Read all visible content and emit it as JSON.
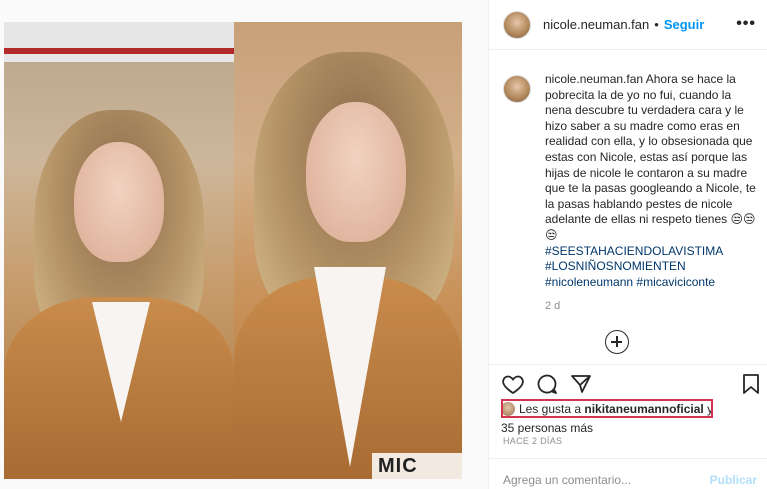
{
  "post": {
    "username": "nicole.neuman.fan",
    "follow_label": "Seguir",
    "more_label": "•••",
    "dot": "•",
    "caption": {
      "username": "nicole.neuman.fan",
      "text": "Ahora se hace la pobrecita la de yo no fui, cuando la nena descubre tu verdadera cara y le hizo saber a su madre como eras en realidad con ella, y lo obsesionada que estas con Nicole, estas así porque las hijas de nicole le contaron a su madre que te la pasas googleando a Nicole, te la pasas hablando pestes de nicole adelante de ellas ni respeto tienes 😒😒😒",
      "hashtags": [
        "#SEESTAHACIENDOLAVISTIMA",
        "#LOSNIÑOSNOMIENTEN",
        "#nicoleneumann #micaviciconte"
      ],
      "time": "2 d"
    },
    "likes": {
      "prefix": "Les gusta a",
      "user": "nikitaneumannoficial",
      "connector": "y",
      "rest": "35 personas más"
    },
    "timestamp": "HACE 2 DÍAS",
    "comment_placeholder": "Agrega un comentario...",
    "publish_label": "Publicar"
  },
  "media": {
    "overlay_text": "MIC"
  },
  "icons": {
    "like": "heart-icon",
    "comment": "comment-icon",
    "share": "share-icon",
    "save": "bookmark-icon",
    "more": "ellipsis-icon",
    "add": "plus-circle-icon"
  },
  "colors": {
    "link_blue": "#0095f6",
    "hashtag_blue": "#00376b",
    "highlight_red": "#d2364e",
    "muted": "#8e8e8e",
    "publish_disabled": "#b2dffc"
  }
}
